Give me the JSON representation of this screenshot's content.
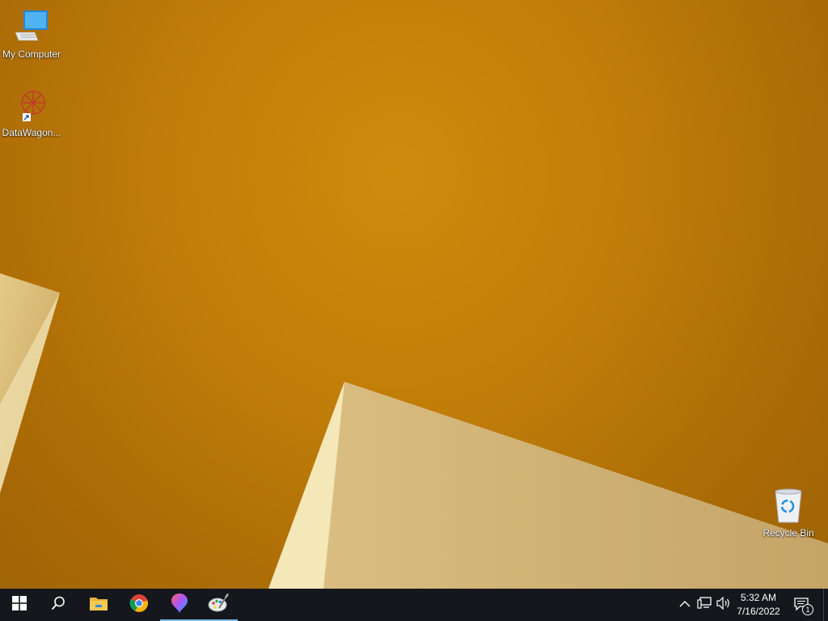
{
  "desktop": {
    "icons": [
      {
        "label": "My Computer",
        "icon": "my-computer-icon"
      },
      {
        "label": "DataWagon...",
        "icon": "datawagon-icon"
      },
      {
        "label": "Recycle Bin",
        "icon": "recycle-bin-icon"
      }
    ]
  },
  "taskbar": {
    "buttons": [
      {
        "icon": "windows-start-icon",
        "active": false
      },
      {
        "icon": "search-icon",
        "active": false
      },
      {
        "icon": "file-explorer-icon",
        "active": false
      },
      {
        "icon": "chrome-icon",
        "active": false
      },
      {
        "icon": "paint-3d-icon",
        "active": true
      },
      {
        "icon": "paint-palette-icon",
        "active": true
      }
    ],
    "tray": {
      "icons": [
        "chevron-up-icon",
        "network-icon",
        "volume-icon"
      ],
      "time": "5:32 AM",
      "date": "7/16/2022",
      "notification_count": "1"
    }
  },
  "colors": {
    "wallpaper": "#c07d09",
    "taskbar": "#15171d",
    "active_indicator": "#76b9ed"
  }
}
